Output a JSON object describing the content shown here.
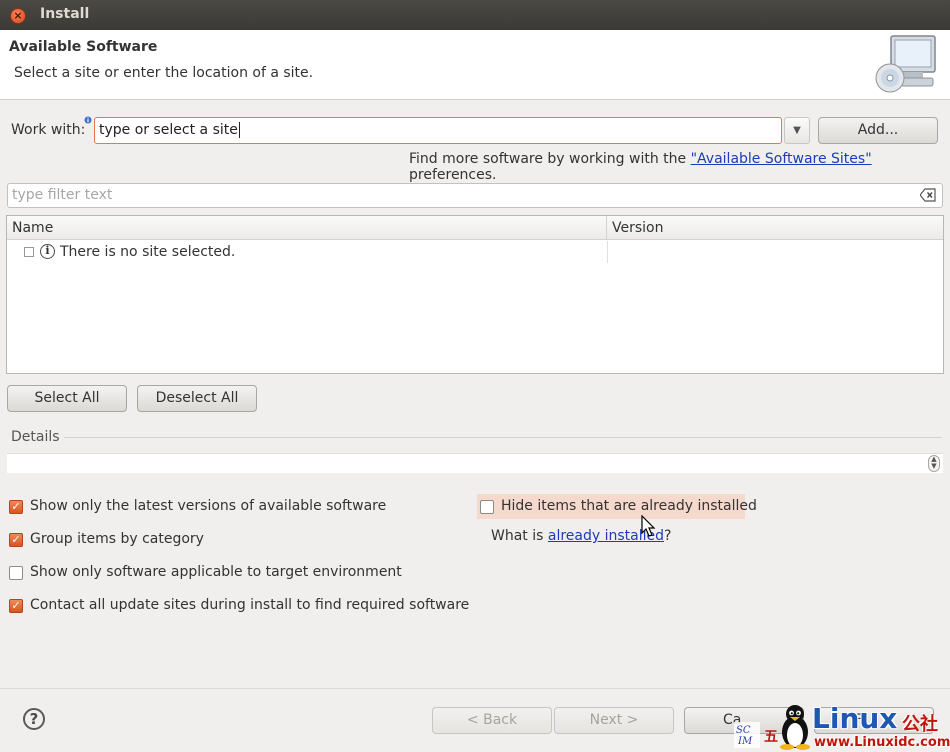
{
  "window": {
    "title": "Install"
  },
  "header": {
    "title": "Available Software",
    "description": "Select a site or enter the location of a site."
  },
  "work_with": {
    "label": "Work with:",
    "value": "type or select a site",
    "add_label": "Add..."
  },
  "find_more": {
    "prefix": "Find more software by working with the ",
    "link": "\"Available Software Sites\"",
    "suffix": " preferences."
  },
  "filter": {
    "placeholder": "type filter text"
  },
  "table": {
    "columns": [
      "Name",
      "Version"
    ],
    "rows": [
      {
        "name": "There is no site selected.",
        "version": ""
      }
    ]
  },
  "buttons": {
    "select_all": "Select All",
    "deselect_all": "Deselect All",
    "back": "< Back",
    "next": "Next >",
    "cancel": "Ca",
    "finish": "Fi"
  },
  "details": {
    "label": "Details"
  },
  "options": {
    "latest_versions": {
      "label": "Show only the latest versions of available software",
      "checked": true
    },
    "group_by_category": {
      "label": "Group items by category",
      "checked": true
    },
    "target_env": {
      "label": "Show only software applicable to target environment",
      "checked": false
    },
    "contact_sites": {
      "label": "Contact all update sites during install to find required software",
      "checked": true
    },
    "hide_installed": {
      "label": "Hide items that are already installed",
      "checked": false
    }
  },
  "what_is": {
    "prefix": "What is ",
    "link": "already installed",
    "suffix": "?"
  },
  "watermark": {
    "brand": "Linux",
    "brand_cn": "公社",
    "url": "www.Linuxidc.com",
    "logo_text": "SCIM",
    "char": "五"
  },
  "colors": {
    "accent": "#dd4814",
    "link": "#1e3cb8",
    "titlebar": "#3c3b37"
  }
}
